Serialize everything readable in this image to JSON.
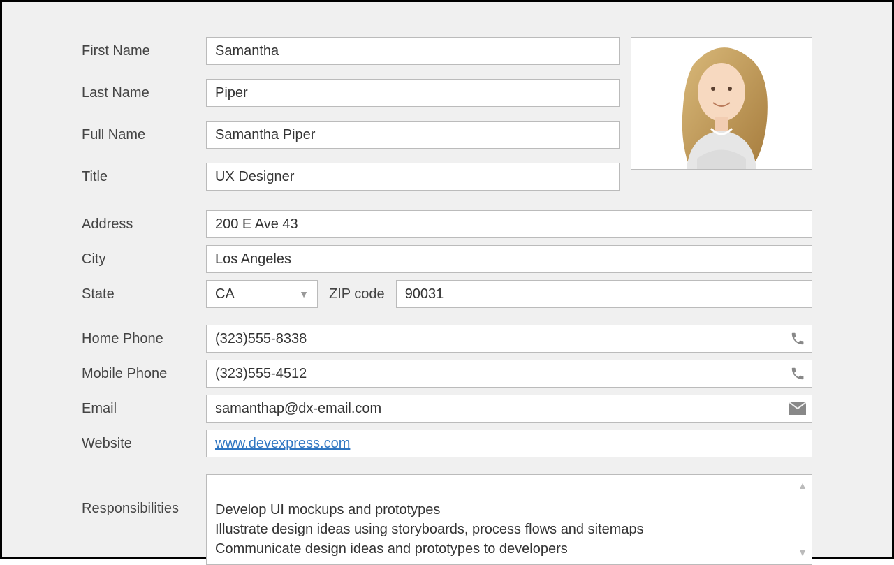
{
  "labels": {
    "first_name": "First Name",
    "last_name": "Last Name",
    "full_name": "Full Name",
    "title": "Title",
    "address": "Address",
    "city": "City",
    "state": "State",
    "zip": "ZIP code",
    "home_phone": "Home Phone",
    "mobile_phone": "Mobile Phone",
    "email": "Email",
    "website": "Website",
    "responsibilities": "Responsibilities"
  },
  "values": {
    "first_name": "Samantha",
    "last_name": "Piper",
    "full_name": "Samantha Piper",
    "title": "UX Designer",
    "address": "200 E Ave 43",
    "city": "Los Angeles",
    "state": "CA",
    "zip": "90031",
    "home_phone": "(323)555-8338",
    "mobile_phone": "(323)555-4512",
    "email": "samanthap@dx-email.com",
    "website": "www.devexpress.com",
    "responsibilities": "Develop UI mockups and prototypes\nIllustrate design ideas using storyboards, process flows and sitemaps\nCommunicate design ideas and prototypes to developers"
  }
}
